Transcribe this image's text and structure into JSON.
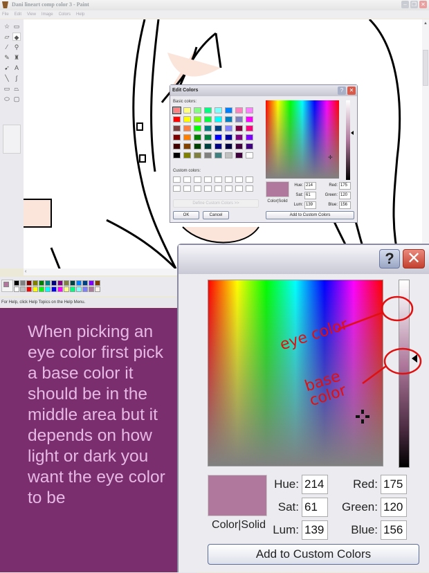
{
  "window": {
    "title": "Dani lineart comp color 3 - Paint",
    "controls": {
      "minimize": "–",
      "maximize": "❐",
      "close": "✕"
    }
  },
  "menubar": [
    "File",
    "Edit",
    "View",
    "Image",
    "Colors",
    "Help"
  ],
  "toolbox": {
    "tools": [
      {
        "name": "free-form-select",
        "glyph": "☆"
      },
      {
        "name": "select",
        "glyph": "▭"
      },
      {
        "name": "eraser",
        "glyph": "▱"
      },
      {
        "name": "fill-with-color",
        "glyph": "◆",
        "selected": true
      },
      {
        "name": "pick-color",
        "glyph": "⁄"
      },
      {
        "name": "magnifier",
        "glyph": "⚲"
      },
      {
        "name": "pencil",
        "glyph": "✎"
      },
      {
        "name": "brush",
        "glyph": "♜"
      },
      {
        "name": "airbrush",
        "glyph": "➹"
      },
      {
        "name": "text",
        "glyph": "A"
      },
      {
        "name": "line",
        "glyph": "╲"
      },
      {
        "name": "curve",
        "glyph": "∫"
      },
      {
        "name": "rectangle",
        "glyph": "▭"
      },
      {
        "name": "polygon",
        "glyph": "⏢"
      },
      {
        "name": "ellipse",
        "glyph": "⬭"
      },
      {
        "name": "rounded-rectangle",
        "glyph": "▢"
      }
    ]
  },
  "palette": {
    "foreground": "#af789c",
    "background": "#ffffff",
    "row1": [
      "#000000",
      "#808080",
      "#800000",
      "#808000",
      "#008000",
      "#008080",
      "#000080",
      "#800080",
      "#808040",
      "#004040",
      "#0080ff",
      "#004080",
      "#8000ff",
      "#804000"
    ],
    "row2": [
      "#ffffff",
      "#c0c0c0",
      "#ff0000",
      "#ffff00",
      "#00ff00",
      "#00ffff",
      "#0000ff",
      "#ff00ff",
      "#ffff80",
      "#00ff80",
      "#80ffff",
      "#8080ff",
      "#af789c",
      "#f8f0e8"
    ]
  },
  "statusbar": {
    "text": "For Help, click Help Topics on the Help Menu."
  },
  "edit_colors_small": {
    "title": "Edit Colors",
    "help": "?",
    "close": "✕",
    "basic_colors_label": "Basic colors:",
    "basic_colors": [
      "#ff8080",
      "#ffff80",
      "#80ff80",
      "#00ff80",
      "#80ffff",
      "#0080ff",
      "#ff80c0",
      "#ff80ff",
      "#ff0000",
      "#ffff00",
      "#80ff00",
      "#00ff40",
      "#00ffff",
      "#0080c0",
      "#8080c0",
      "#ff00ff",
      "#804040",
      "#ff8040",
      "#00ff00",
      "#008080",
      "#004080",
      "#8080ff",
      "#800040",
      "#ff0080",
      "#800000",
      "#ff8000",
      "#008000",
      "#008040",
      "#0000ff",
      "#0000a0",
      "#800080",
      "#8000ff",
      "#400000",
      "#804000",
      "#004000",
      "#004040",
      "#000080",
      "#000040",
      "#400040",
      "#400080",
      "#000000",
      "#808000",
      "#808040",
      "#808080",
      "#408080",
      "#c0c0c0",
      "#400040",
      "#ffffff"
    ],
    "custom_colors_label": "Custom colors:",
    "define_custom_label": "Define Custom Colors >>",
    "ok_label": "OK",
    "cancel_label": "Cancel",
    "preview_label": "Color|Solid",
    "hue_label": "Hue:",
    "hue": "214",
    "sat_label": "Sat:",
    "sat": "61",
    "lum_label": "Lum:",
    "lum": "139",
    "red_label": "Red:",
    "red": "175",
    "green_label": "Green:",
    "green": "120",
    "blue_label": "Blue:",
    "blue": "156",
    "add_custom_label": "Add to Custom Colors",
    "selected_color": "#af789c"
  },
  "edit_colors_large": {
    "help": "?",
    "close": "✕",
    "preview_label": "Color|Solid",
    "hue_label": "Hue:",
    "hue": "214",
    "sat_label": "Sat:",
    "sat": "61",
    "lum_label": "Lum:",
    "lum": "139",
    "red_label": "Red:",
    "red": "175",
    "green_label": "Green:",
    "green": "120",
    "blue_label": "Blue:",
    "blue": "156",
    "add_custom_label": "Add to Custom Colors",
    "selected_color": "#af789c"
  },
  "annotations": {
    "eye_color": "eye color",
    "base_color": "base color",
    "color": "#e01010"
  },
  "tip": {
    "text": "When picking an eye color first pick a base color it should be in the middle area but it depends on how light or dark you want the eye color to be",
    "background": "#7b2e6e",
    "text_color": "#e6b8e4"
  }
}
